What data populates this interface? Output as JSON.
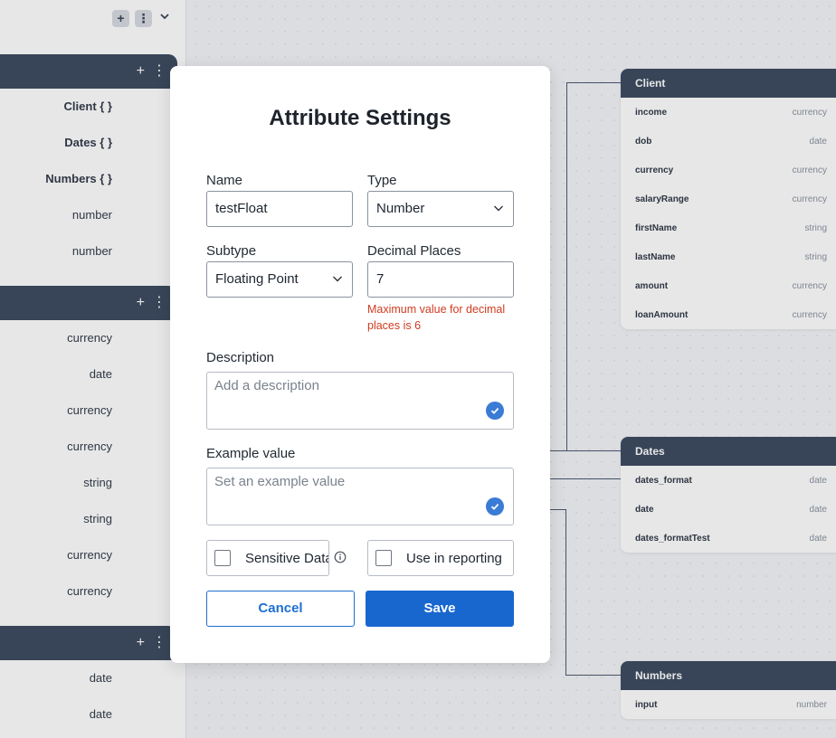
{
  "left_panel": {
    "top_tools": [
      "+",
      "⋮",
      "⌄"
    ],
    "cards": [
      {
        "rows": [
          {
            "label": "Client { }",
            "bold": true
          },
          {
            "label": "Dates { }",
            "bold": true
          },
          {
            "label": "Numbers { }",
            "bold": true
          },
          {
            "label": "number",
            "bold": false
          },
          {
            "label": "number",
            "bold": false
          }
        ]
      },
      {
        "rows": [
          {
            "label": "currency"
          },
          {
            "label": "date"
          },
          {
            "label": "currency"
          },
          {
            "label": "currency"
          },
          {
            "label": "string"
          },
          {
            "label": "string"
          },
          {
            "label": "currency"
          },
          {
            "label": "currency"
          }
        ]
      },
      {
        "rows": [
          {
            "label": "date"
          },
          {
            "label": "date"
          }
        ]
      }
    ],
    "header_tools": [
      "+",
      "⋮"
    ]
  },
  "canvas": {
    "client": {
      "title": "Client",
      "rows": [
        {
          "name": "income",
          "type": "currency"
        },
        {
          "name": "dob",
          "type": "date"
        },
        {
          "name": "currency",
          "type": "currency"
        },
        {
          "name": "salaryRange",
          "type": "currency"
        },
        {
          "name": "firstName",
          "type": "string"
        },
        {
          "name": "lastName",
          "type": "string"
        },
        {
          "name": "amount",
          "type": "currency"
        },
        {
          "name": "loanAmount",
          "type": "currency"
        }
      ]
    },
    "dates": {
      "title": "Dates",
      "rows": [
        {
          "name": "dates_format",
          "type": "date"
        },
        {
          "name": "date",
          "type": "date"
        },
        {
          "name": "dates_formatTest",
          "type": "date"
        }
      ]
    },
    "numbers": {
      "title": "Numbers",
      "rows": [
        {
          "name": "input",
          "type": "number"
        }
      ]
    }
  },
  "modal": {
    "title": "Attribute Settings",
    "name_label": "Name",
    "name_value": "testFloat",
    "type_label": "Type",
    "type_value": "Number",
    "subtype_label": "Subtype",
    "subtype_value": "Floating Point",
    "decimal_label": "Decimal Places",
    "decimal_value": "7",
    "decimal_error": "Maximum value for decimal places is 6",
    "description_label": "Description",
    "description_placeholder": "Add a description",
    "example_label": "Example value",
    "example_placeholder": "Set an example value",
    "sensitive_label": "Sensitive Data",
    "reporting_label": "Use in reporting",
    "cancel_label": "Cancel",
    "save_label": "Save"
  },
  "colors": {
    "header_dark": "#3d4b5f",
    "primary": "#1867cf",
    "error": "#d13b1f",
    "check_badge": "#3a7bd5"
  }
}
